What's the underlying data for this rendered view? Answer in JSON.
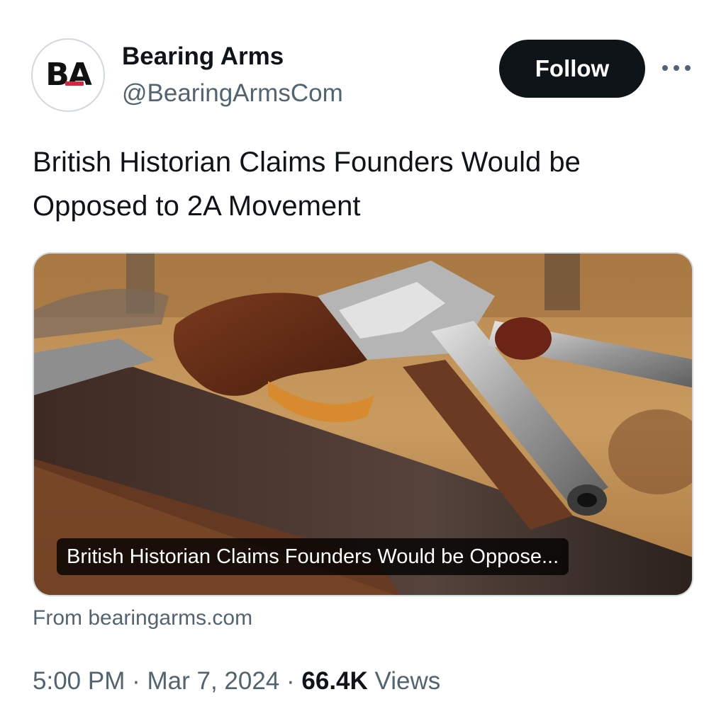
{
  "account": {
    "name": "Bearing Arms",
    "handle": "@BearingArmsCom",
    "avatar_text": "BA",
    "avatar_accent": "#d7263d"
  },
  "follow_label": "Follow",
  "more_icon": "more-horizontal-icon",
  "tweet": {
    "text": "British Historian Claims Founders Would be Opposed to 2A Movement"
  },
  "card": {
    "image_subject": "flintlock pistols on wooden table",
    "caption": "British Historian Claims Founders Would be Oppose...",
    "source": "From bearingarms.com"
  },
  "meta": {
    "time": "5:00 PM",
    "separator": "·",
    "date": "Mar 7, 2024",
    "views_count": "66.4K",
    "views_label": "Views"
  },
  "colors": {
    "text_primary": "#0f1419",
    "text_secondary": "#536471",
    "follow_bg": "#0f1419",
    "border": "#cfd9de"
  }
}
